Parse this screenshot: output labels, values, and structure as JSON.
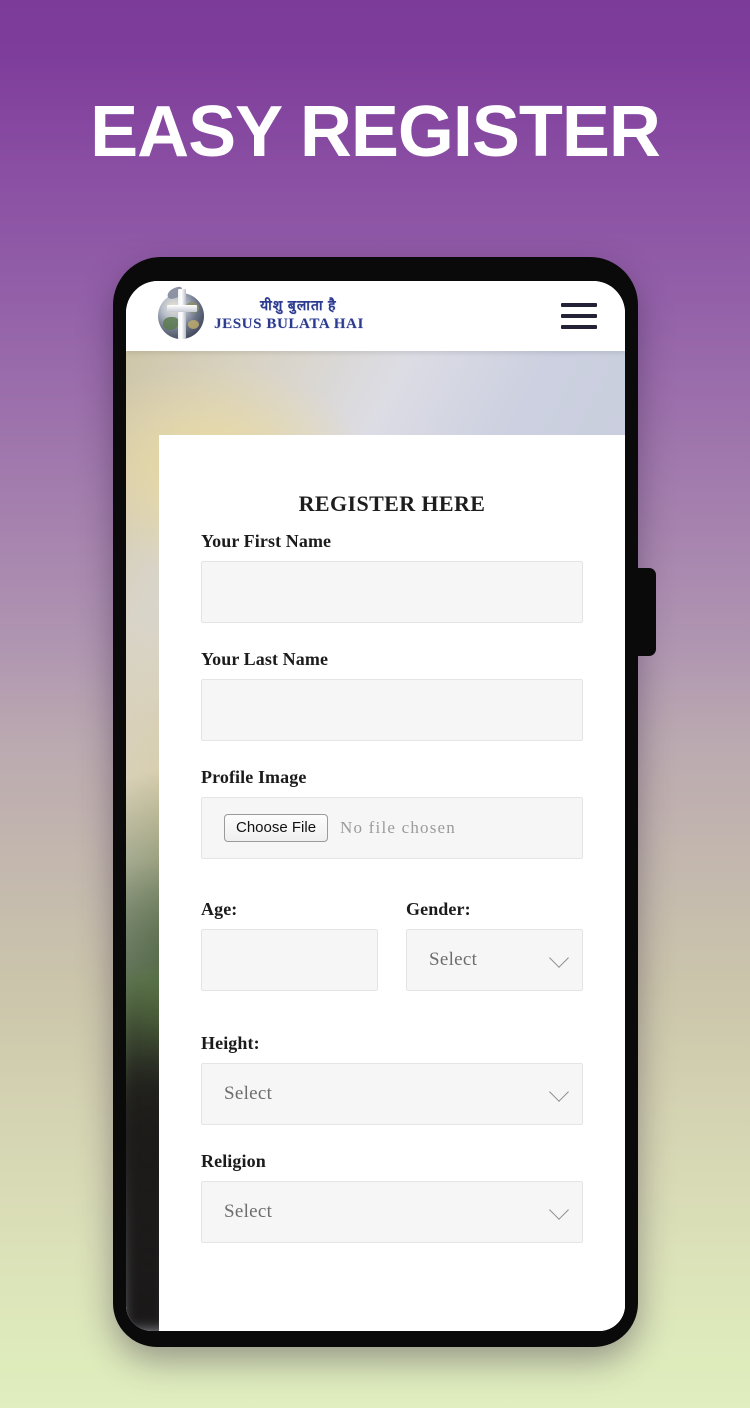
{
  "promo": {
    "headline": "EASY REGISTER",
    "background_top_color": "#7e3d9b",
    "background_mid_color": "#bbaab0",
    "background_bottom_color": "#deecbc"
  },
  "device": {
    "frame_color": "#0a0a0a",
    "power_button_name": "power-button"
  },
  "app_header": {
    "brand_name_hindi": "यीशु बुलाता है",
    "brand_name_english": "JESUS BULATA HAI",
    "brand_text_color": "#2b3a8f",
    "logo_icon": "globe-cross-icon",
    "menu_icon": "hamburger-menu-icon"
  },
  "form": {
    "title": "REGISTER HERE",
    "fields": [
      {
        "label": "Your First Name",
        "type": "text",
        "value": "",
        "placeholder": ""
      },
      {
        "label": "Your Last Name",
        "type": "text",
        "value": "",
        "placeholder": ""
      },
      {
        "label": "Profile Image",
        "type": "file",
        "button_label": "Choose File",
        "status_text": "No file chosen"
      },
      {
        "label": "Age:",
        "type": "text",
        "value": "",
        "placeholder": ""
      },
      {
        "label": "Gender:",
        "type": "select",
        "value": "Select"
      },
      {
        "label": "Height:",
        "type": "select",
        "value": "Select"
      },
      {
        "label": "Religion",
        "type": "select",
        "value": "Select"
      }
    ]
  }
}
